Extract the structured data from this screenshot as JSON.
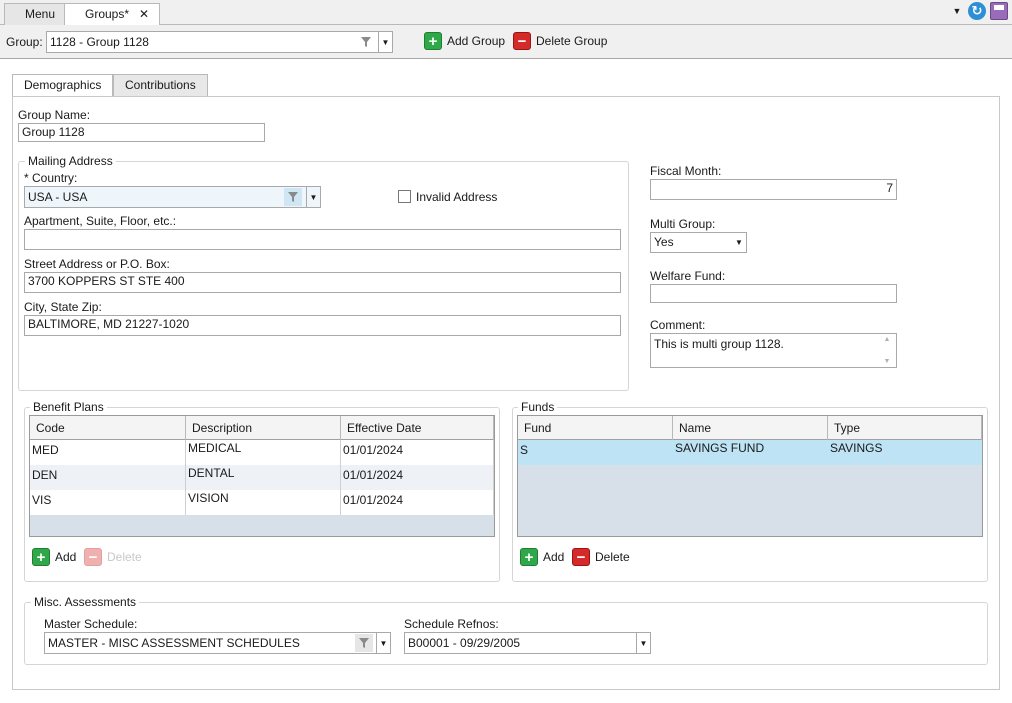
{
  "tabs": {
    "menu": "Menu",
    "groups": "Groups*",
    "close": "✕"
  },
  "toolbar": {
    "group_label": "Group:",
    "group_value": "1128 - Group 1128",
    "add_group": "Add Group",
    "delete_group": "Delete Group"
  },
  "panel_tabs": {
    "demographics": "Demographics",
    "contributions": "Contributions"
  },
  "demographics": {
    "group_name_label": "Group Name:",
    "group_name_value": "Group 1128",
    "mailing_address": {
      "legend": "Mailing Address",
      "country_label": "* Country:",
      "country_value": "USA - USA",
      "invalid_address_label": "Invalid Address",
      "invalid_address_checked": false,
      "apartment_label": "Apartment, Suite, Floor, etc.:",
      "apartment_value": "",
      "street_label": "Street Address or P.O. Box:",
      "street_value": "3700 KOPPERS ST STE 400",
      "city_label": "City, State Zip:",
      "city_value": "BALTIMORE, MD 21227-1020"
    },
    "fiscal_month_label": "Fiscal Month:",
    "fiscal_month_value": "7",
    "multi_group_label": "Multi Group:",
    "multi_group_value": "Yes",
    "welfare_fund_label": "Welfare Fund:",
    "welfare_fund_value": "",
    "comment_label": "Comment:",
    "comment_value": "This is multi group 1128.",
    "benefit_plans": {
      "legend": "Benefit Plans",
      "columns": [
        "Code",
        "Description",
        "Effective Date"
      ],
      "rows": [
        [
          "MED",
          "MEDICAL",
          "01/01/2024"
        ],
        [
          "DEN",
          "DENTAL",
          "01/01/2024"
        ],
        [
          "VIS",
          "VISION",
          "01/01/2024"
        ]
      ],
      "add": "Add",
      "delete": "Delete"
    },
    "funds": {
      "legend": "Funds",
      "columns": [
        "Fund",
        "Name",
        "Type"
      ],
      "rows": [
        [
          "S",
          "SAVINGS FUND",
          "SAVINGS"
        ]
      ],
      "add": "Add",
      "delete": "Delete"
    },
    "misc": {
      "legend": "Misc. Assessments",
      "master_label": "Master Schedule:",
      "master_value": "MASTER - MISC ASSESSMENT SCHEDULES",
      "refnos_label": "Schedule Refnos:",
      "refnos_value": "B00001 - 09/29/2005"
    }
  },
  "colors": {
    "add_green": "#2fa84a",
    "delete_red": "#d42a2a",
    "selected_row": "#bde3f5",
    "grid_empty": "#d7dfe9"
  }
}
